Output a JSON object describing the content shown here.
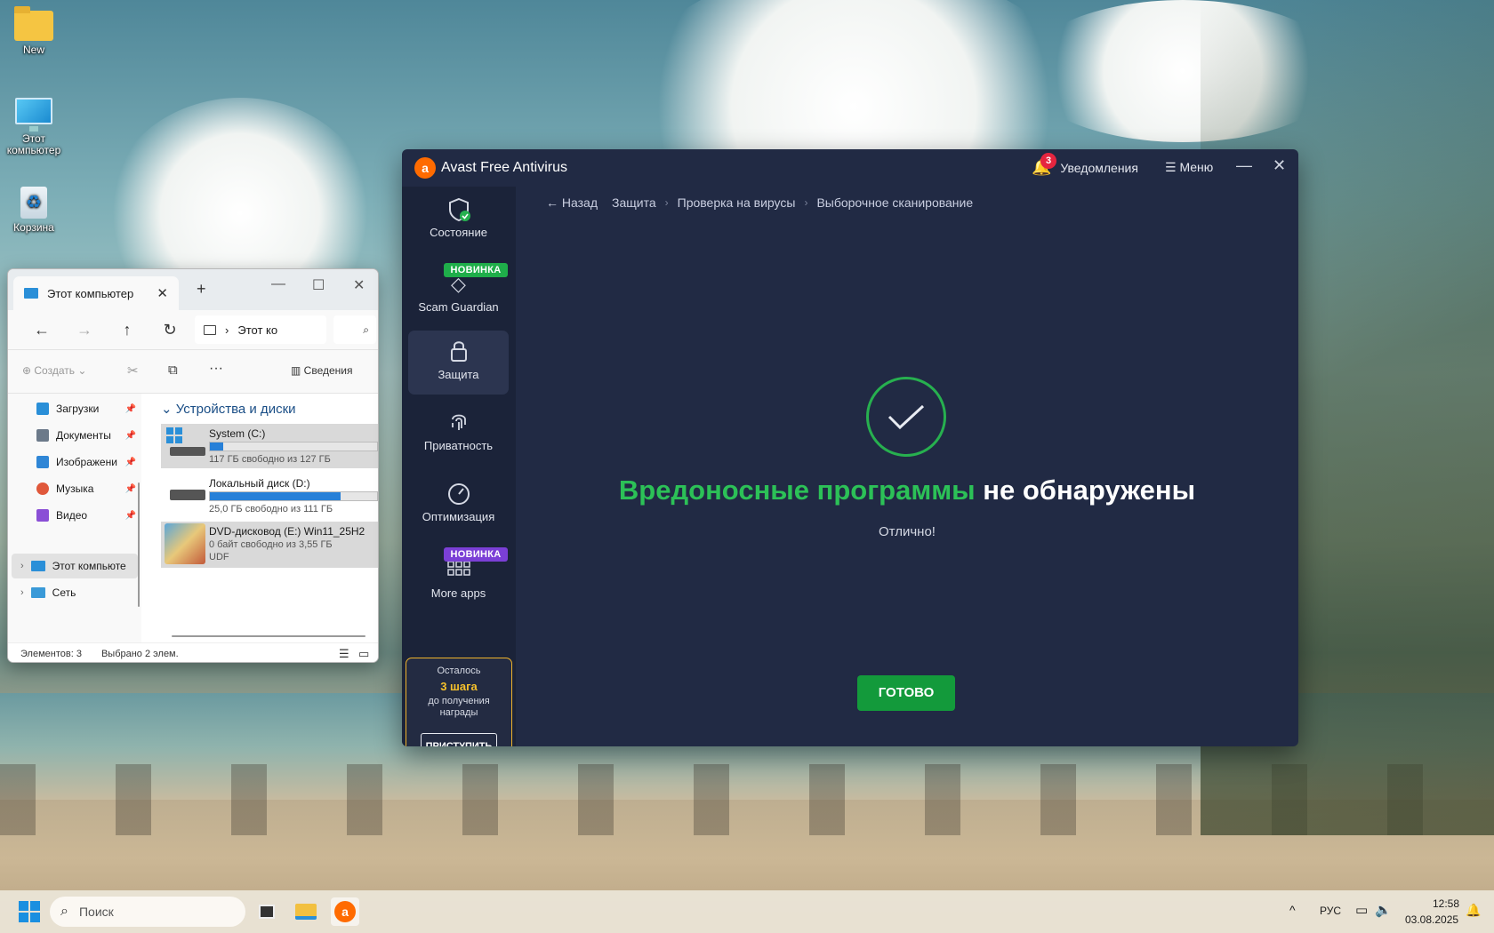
{
  "desktop": {
    "icons": [
      {
        "label": "New"
      },
      {
        "label": "Этот компьютер"
      },
      {
        "label": "Корзина"
      }
    ]
  },
  "explorer": {
    "tab_title": "Этот компьютер",
    "address_text": "Этот ко",
    "cmd": {
      "create": "Создать",
      "details": "Сведения"
    },
    "sidebar": {
      "pinned": [
        {
          "label": "Загрузки",
          "color": "#2a8fd8"
        },
        {
          "label": "Документы",
          "color": "#6c7a8a"
        },
        {
          "label": "Изображени",
          "color": "#2f86d6"
        },
        {
          "label": "Музыка",
          "color": "#e0583b"
        },
        {
          "label": "Видео",
          "color": "#8a4fd6"
        }
      ],
      "tree": [
        {
          "label": "Этот компьюте"
        },
        {
          "label": "Сеть"
        }
      ]
    },
    "group_header": "Устройства и диски",
    "drives": [
      {
        "name": "System (C:)",
        "info": "117 ГБ свободно из 127 ГБ",
        "used_fraction": 0.08
      },
      {
        "name": "Локальный диск (D:)",
        "info": "25,0 ГБ свободно из 111 ГБ",
        "used_fraction": 0.78
      },
      {
        "name": "DVD-дисковод (E:) Win11_25H2",
        "info": "0 байт свободно из 3,55 ГБ",
        "info2": "UDF"
      }
    ],
    "status": {
      "items_count": "Элементов: 3",
      "selected": "Выбрано 2 элем."
    }
  },
  "avast": {
    "title": "Avast Free Antivirus",
    "notifications_label": "Уведомления",
    "notifications_count": "3",
    "menu_label": "Меню",
    "nav": [
      {
        "label": "Состояние"
      },
      {
        "label": "Scam Guardian",
        "badge": "НОВИНКА"
      },
      {
        "label": "Защита"
      },
      {
        "label": "Приватность"
      },
      {
        "label": "Оптимизация"
      },
      {
        "label": "More apps",
        "badge": "НОВИНКА"
      }
    ],
    "reward": {
      "line1": "Осталось",
      "steps": "3 шага",
      "line2": "до получения",
      "line3": "награды",
      "button": "ПРИСТУПИТЬ"
    },
    "breadcrumb": {
      "back": "Назад",
      "items": [
        "Защита",
        "Проверка на вирусы",
        "Выборочное сканирование"
      ]
    },
    "result": {
      "green_part": "Вредоносные программы",
      "white_part": "не обнаружены",
      "subtitle": "Отлично!"
    },
    "done_button": "ГОТОВО",
    "colors": {
      "accent_green": "#2cc157",
      "button_green": "#139a3b",
      "badge_green": "#1fae4a",
      "badge_purple": "#7b3fd6",
      "reward_gold": "#f0b42c"
    }
  },
  "taskbar": {
    "search_placeholder": "Поиск",
    "language": "РУС",
    "time": "12:58",
    "date": "03.08.2025"
  }
}
